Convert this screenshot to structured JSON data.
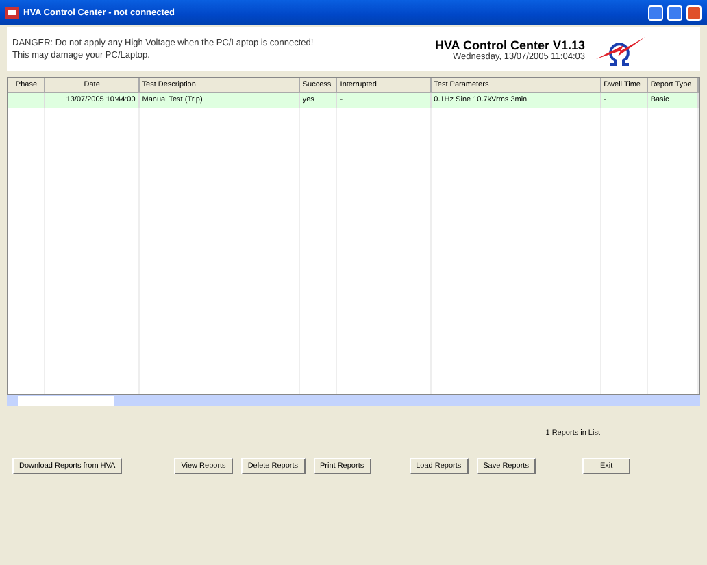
{
  "window": {
    "title": "HVA Control Center - not connected"
  },
  "header": {
    "warning_lines": [
      "DANGER: Do not apply any High Voltage when the PC/Laptop is connected!",
      "This may damage your PC/Laptop."
    ],
    "app_name": "HVA Control Center V1.13",
    "datetime": "Wednesday, 13/07/2005 11:04:03"
  },
  "table": {
    "columns": [
      "Phase",
      "Date",
      "Test Description",
      "Success",
      "Interrupted",
      "Test Parameters",
      "Dwell Time",
      "Report Type"
    ],
    "rows": [
      {
        "cells": [
          "",
          "13/07/2005 10:44:00",
          "Manual Test (Trip)",
          "yes",
          "-",
          "0.1Hz Sine 10.7kVrms 3min",
          "-",
          "Basic"
        ],
        "selected": true
      }
    ]
  },
  "report_count": "1 Reports in List",
  "buttons": [
    "Download Reports from HVA",
    "View Reports",
    "Delete Reports",
    "Print Reports",
    "Load Reports",
    "Save Reports",
    "Exit"
  ]
}
